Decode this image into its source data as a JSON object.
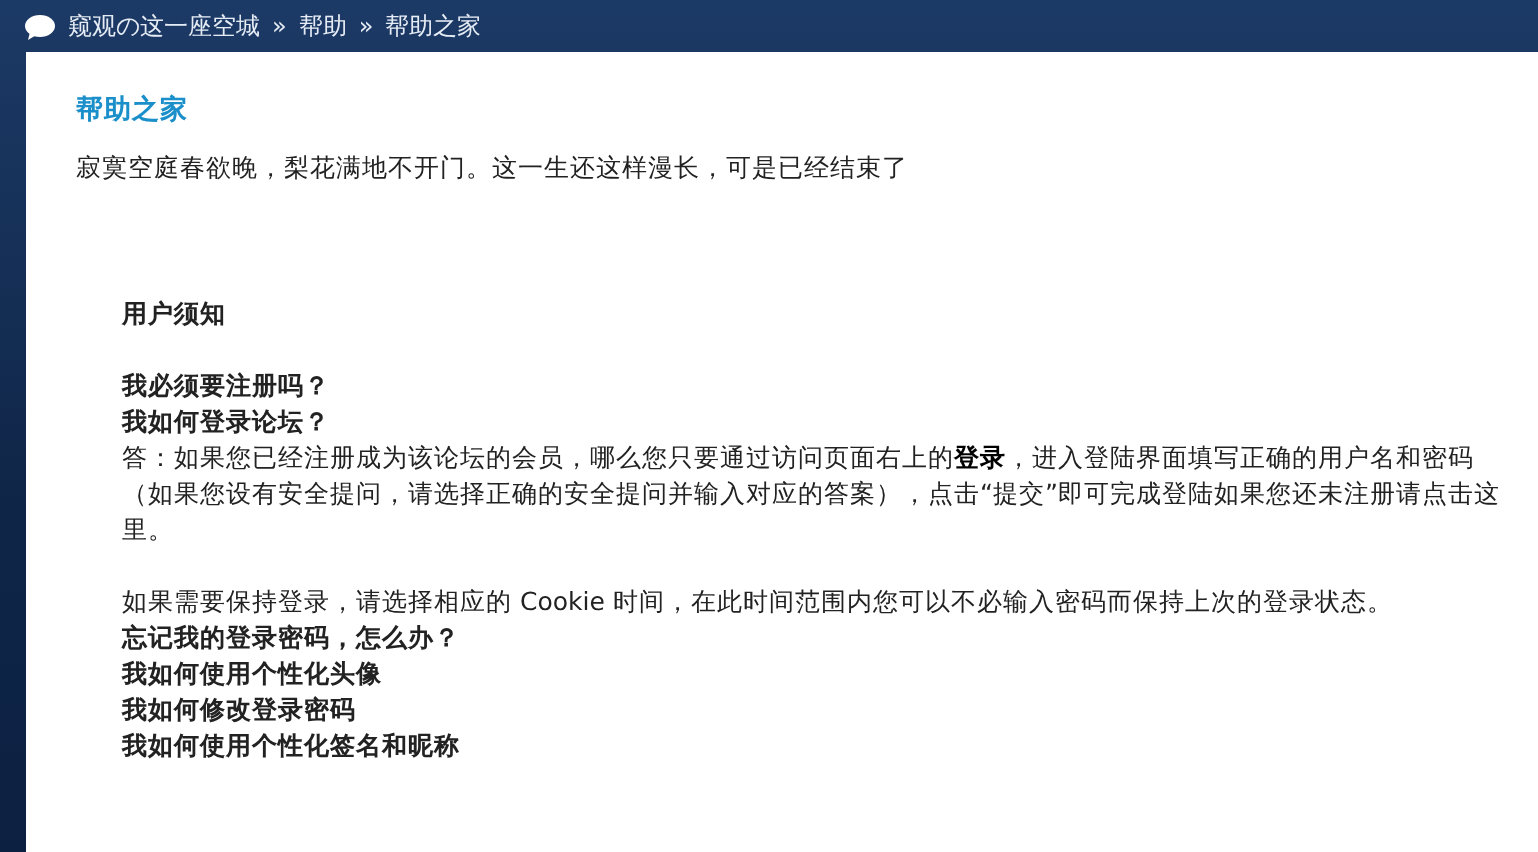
{
  "breadcrumb": {
    "items": [
      "窥观の这一座空城",
      "帮助",
      "帮助之家"
    ],
    "separator": "»"
  },
  "panel": {
    "title": "帮助之家",
    "subtitle": "寂寞空庭春欲晚，梨花满地不开门。这一生还这样漫长，可是已经结束了"
  },
  "faq_sections": [
    [
      {
        "kind": "heading",
        "text": "用户须知"
      }
    ],
    [
      {
        "kind": "question",
        "text": "我必须要注册吗？"
      },
      {
        "kind": "question",
        "text": "我如何登录论坛？"
      },
      {
        "kind": "answer",
        "text": "答：如果您已经注册成为该论坛的会员，哪么您只要通过访问页面右上的**登录**，进入登陆界面填写正确的用户名和密码（如果您设有安全提问，请选择正确的安全提问并输入对应的答案），点击“提交”即可完成登陆如果您还未注册请点击这里。"
      }
    ],
    [
      {
        "kind": "answer",
        "text": "如果需要保持登录，请选择相应的 Cookie 时间，在此时间范围内您可以不必输入密码而保持上次的登录状态。"
      },
      {
        "kind": "question",
        "text": "忘记我的登录密码，怎么办？"
      },
      {
        "kind": "question",
        "text": "我如何使用个性化头像"
      },
      {
        "kind": "question",
        "text": "我如何修改登录密码"
      },
      {
        "kind": "question",
        "text": "我如何使用个性化签名和昵称"
      }
    ]
  ]
}
